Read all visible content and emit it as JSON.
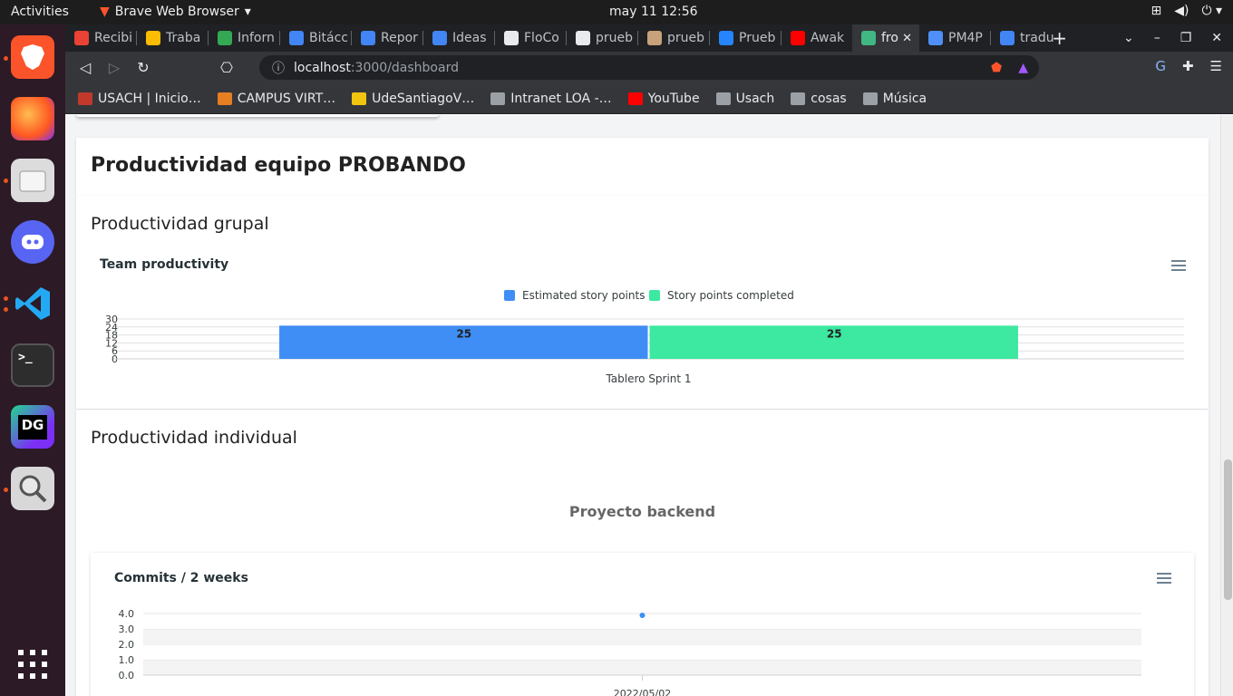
{
  "system": {
    "activities": "Activities",
    "app_name": "Brave Web Browser",
    "clock": "may 11  12:56"
  },
  "browser": {
    "tabs": [
      {
        "label": "Recibi",
        "color": "#ea4335"
      },
      {
        "label": "Traba",
        "color": "#fbbc04"
      },
      {
        "label": "Inforn",
        "color": "#34a853"
      },
      {
        "label": "Bitácc",
        "color": "#4285f4"
      },
      {
        "label": "Repor",
        "color": "#4285f4"
      },
      {
        "label": "Ideas",
        "color": "#4285f4"
      },
      {
        "label": "FloCo",
        "color": "#e8eaed"
      },
      {
        "label": "prueb",
        "color": "#e8eaed"
      },
      {
        "label": "prueb",
        "color": "#c8a27a"
      },
      {
        "label": "Prueb",
        "color": "#2684ff"
      },
      {
        "label": "Awak",
        "color": "#ff0000"
      },
      {
        "label": "fro",
        "color": "#41b883",
        "active": true
      },
      {
        "label": "PM4P",
        "color": "#4f8ff7"
      },
      {
        "label": "tradu",
        "color": "#4285f4"
      }
    ],
    "url_host": "localhost",
    "url_path": ":3000/dashboard",
    "bookmarks": [
      {
        "label": "USACH | Inicio…",
        "color": "#c0392b"
      },
      {
        "label": "CAMPUS VIRT…",
        "color": "#e67e22"
      },
      {
        "label": "UdeSantiagoV…",
        "color": "#f1c40f"
      },
      {
        "label": "Intranet LOA -…",
        "color": "#9aa0a6"
      },
      {
        "label": "YouTube",
        "color": "#ff0000"
      },
      {
        "label": "Usach",
        "color": "#9aa0a6"
      },
      {
        "label": "cosas",
        "color": "#9aa0a6"
      },
      {
        "label": "Música",
        "color": "#9aa0a6"
      }
    ]
  },
  "dashboard": {
    "title": "Productividad equipo PROBANDO",
    "group_section": "Productividad grupal",
    "individual_section": "Productividad individual",
    "project_title": "Proyecto backend"
  },
  "chart_data": [
    {
      "type": "bar",
      "title": "Team productivity",
      "categories": [
        "Tablero Sprint 1"
      ],
      "series": [
        {
          "name": "Estimated story points",
          "values": [
            25
          ],
          "color": "#3f8ef5"
        },
        {
          "name": "Story points completed",
          "values": [
            25
          ],
          "color": "#3de8a0"
        }
      ],
      "yticks": [
        "0",
        "6",
        "12",
        "18",
        "24",
        "30"
      ],
      "ylim": [
        0,
        30
      ],
      "data_labels": true,
      "legend": "top"
    },
    {
      "type": "line",
      "title": "Commits / 2 weeks",
      "x": [
        "2022/05/02"
      ],
      "series": [
        {
          "values": [
            4
          ],
          "color": "#3f8ef5"
        }
      ],
      "yticks": [
        "0.0",
        "1.0",
        "2.0",
        "3.0",
        "4.0"
      ],
      "ylim": [
        0,
        4
      ]
    }
  ]
}
